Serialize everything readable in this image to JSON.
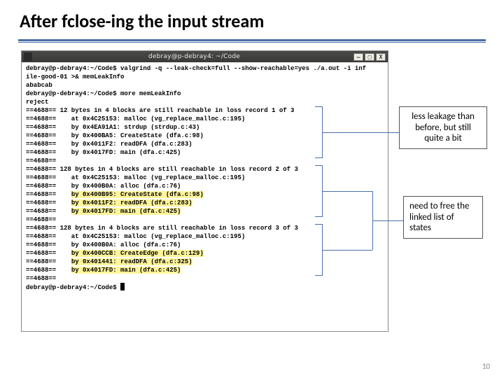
{
  "title": "After fclose-ing the input stream",
  "titlebar": {
    "title": "debray@p-debray4: ~/Code",
    "min": "–",
    "max": "□",
    "close": "X"
  },
  "callouts": {
    "c1": "less leakage than before, but still quite a bit",
    "c2": "need to free the linked list of states"
  },
  "prompt": {
    "user_host": "debray@p-debray4",
    "cwd": "~/Code",
    "sep": ":",
    "dollar": "$ "
  },
  "terminal": {
    "line01a": "debray@p-debray4:~/Code$ valgrind -q --leak-check=full --show-reachable=yes ./a.out -i inf",
    "line01b": "ile-good-01 >& memLeakInfo",
    "line02": "ababcab",
    "line03": "debray@p-debray4:~/Code$ more memLeakInfo",
    "line04": "reject",
    "line05": "==4688== 12 bytes in 4 blocks are still reachable in loss record 1 of 3",
    "line06": "==4688==    at 0x4C25153: malloc (vg_replace_malloc.c:195)",
    "line07": "==4688==    by 0x4EA91A1: strdup (strdup.c:43)",
    "line08": "==4688==    by 0x400BA5: CreateState (dfa.c:98)",
    "line09": "==4688==    by 0x4011F2: readDFA (dfa.c:283)",
    "line10": "==4688==    by 0x4017FD: main (dfa.c:425)",
    "line11": "==4688==",
    "line12": "==4688== 128 bytes in 4 blocks are still reachable in loss record 2 of 3",
    "line13": "==4688==    at 0x4C25153: malloc (vg_replace_malloc.c:195)",
    "line14": "==4688==    by 0x400B0A: alloc (dfa.c:76)",
    "line15p": "==4688==    ",
    "line15h": "by 0x400B95: CreateState (dfa.c:98)",
    "line16p": "==4688==    ",
    "line16h": "by 0x4011F2: readDFA (dfa.c:283)",
    "line17p": "==4688==    ",
    "line17h": "by 0x4017FD: main (dfa.c:425)",
    "line18": "==4688==",
    "line19": "==4688== 128 bytes in 4 blocks are still reachable in loss record 3 of 3",
    "line20": "==4688==    at 0x4C25153: malloc (vg_replace_malloc.c:195)",
    "line21": "==4688==    by 0x400B0A: alloc (dfa.c:76)",
    "line22p": "==4688==    ",
    "line22h": "by 0x400CCB: CreateEdge (dfa.c:129)",
    "line23p": "==4688==    ",
    "line23h": "by 0x401441: readDFA (dfa.c:325)",
    "line24p": "==4688==    ",
    "line24h": "by 0x4017FD: main (dfa.c:425)",
    "line25": "==4688==",
    "line26": "debray@p-debray4:~/Code$ "
  },
  "slide_number": "10"
}
